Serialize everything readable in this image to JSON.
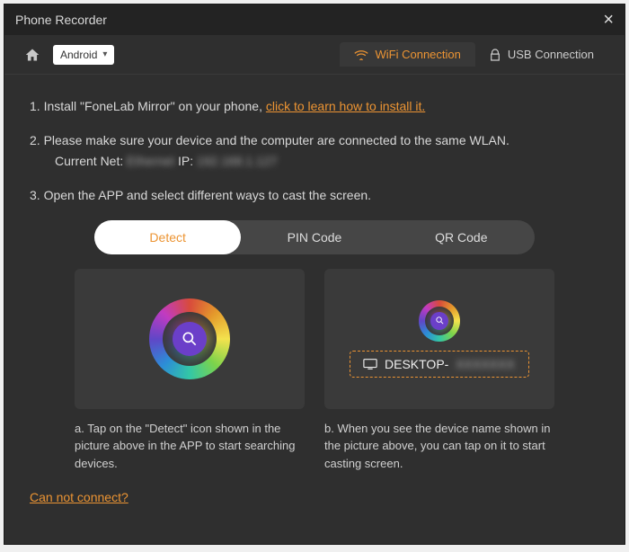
{
  "titlebar": {
    "title": "Phone Recorder"
  },
  "toolbar": {
    "os_label": "Android",
    "tabs": {
      "wifi": "WiFi Connection",
      "usb": "USB Connection"
    }
  },
  "steps": {
    "s1_prefix": "1. Install \"FoneLab Mirror\" on your phone, ",
    "s1_link": "click to learn how to install it.",
    "s2": "2. Please make sure your device and the computer are connected to the same WLAN.",
    "s2_net_label": "Current Net: ",
    "s2_net_value": "Ethernet",
    "s2_ip_label": "   IP: ",
    "s2_ip_value": "192.168.1.127",
    "s3": "3. Open the APP and select different ways to cast the screen."
  },
  "methods": {
    "detect": "Detect",
    "pin": "PIN Code",
    "qr": "QR Code"
  },
  "panels": {
    "device_prefix": "DESKTOP-",
    "device_suffix": "XXXXXXX",
    "caption_a": "a. Tap on the \"Detect\" icon shown in the picture above in the APP to start searching devices.",
    "caption_b": "b. When you see the device name shown in the picture above, you can tap on it to start casting screen."
  },
  "footer": {
    "help_link": "Can not connect?"
  }
}
